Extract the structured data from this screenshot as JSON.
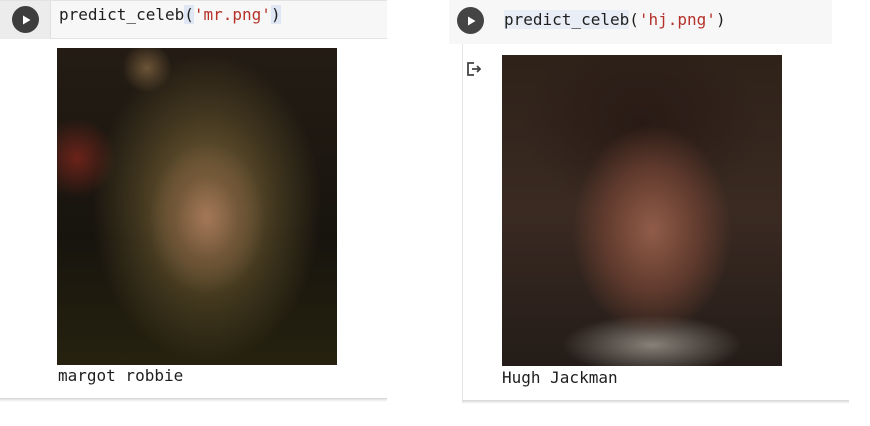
{
  "cells": [
    {
      "code": {
        "function": "predict_celeb",
        "open_paren": "(",
        "argument": "'mr.png'",
        "close_paren": ")"
      },
      "run_icon": "play-icon",
      "image_alt": "mr.png",
      "result": "margot robbie"
    },
    {
      "code": {
        "function": "predict_celeb",
        "open_paren": "(",
        "argument": "'hj.png'",
        "close_paren": ")"
      },
      "run_icon": "play-icon",
      "output_icon": "output-redirect-icon",
      "image_alt": "hj.png",
      "result": "Hugh Jackman"
    }
  ],
  "colors": {
    "string": "#b5322a",
    "run_button": "#3d3d3d",
    "code_background": "#f7f7f7"
  }
}
